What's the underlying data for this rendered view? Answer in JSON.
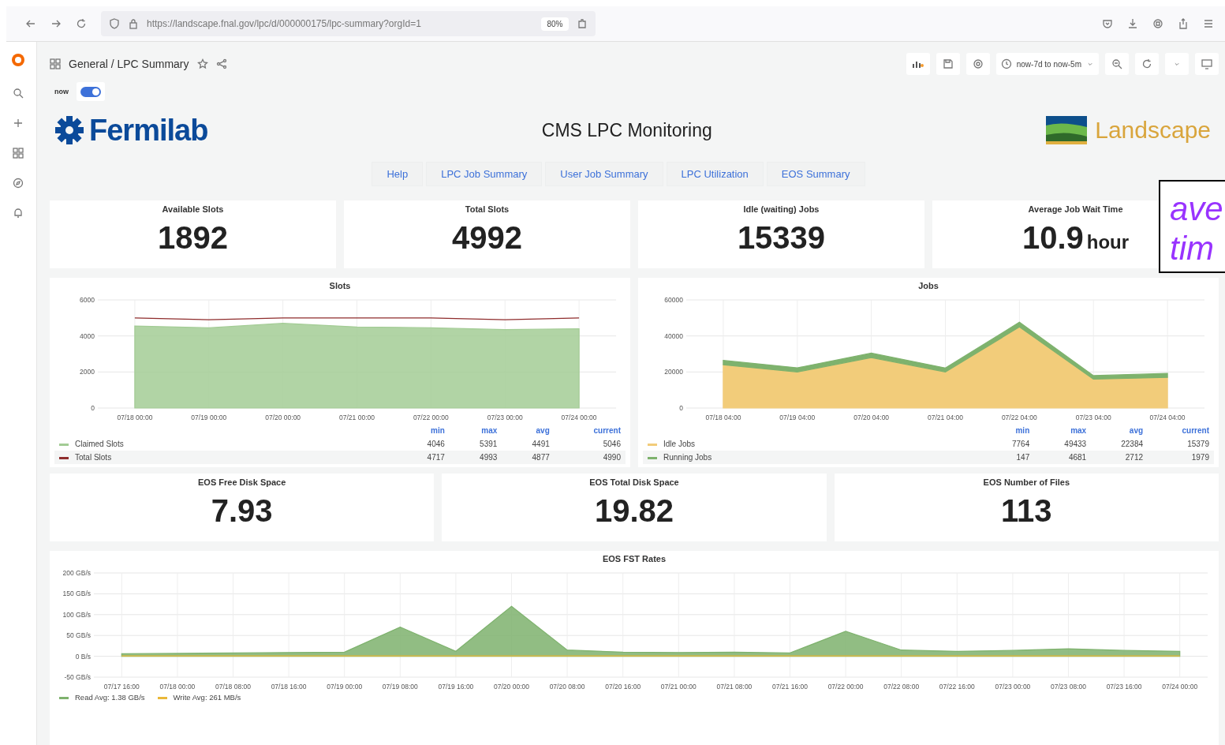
{
  "browser": {
    "url": "https://landscape.fnal.gov/lpc/d/000000175/lpc-summary?orgId=1",
    "zoom": "80%"
  },
  "dashboard": {
    "breadcrumb": "General / LPC Summary",
    "time_range": "now-7d to now-5m"
  },
  "toggle": {
    "label": "now",
    "on": true
  },
  "header": {
    "left_logo": "Fermilab",
    "title": "CMS LPC Monitoring",
    "right_logo": "Landscape"
  },
  "nav_links": [
    "Help",
    "LPC Job Summary",
    "User Job Summary",
    "LPC Utilization",
    "EOS Summary"
  ],
  "stats": [
    {
      "title": "Available Slots",
      "value": "1892"
    },
    {
      "title": "Total Slots",
      "value": "4992"
    },
    {
      "title": "Idle (waiting) Jobs",
      "value": "15339"
    },
    {
      "title": "Average Job Wait Time",
      "value": "10.9",
      "unit": "hour"
    }
  ],
  "charts": [
    {
      "title": "Slots",
      "legend": {
        "headers": [
          "min",
          "max",
          "avg",
          "current"
        ],
        "rows": [
          {
            "min": "4046",
            "max": "5391",
            "avg": "4491",
            "current": "5046"
          },
          {
            "min": "4717",
            "max": "4993",
            "avg": "4877",
            "current": "4990"
          }
        ]
      },
      "chart_data": {
        "type": "area",
        "grid": true,
        "categories": [
          "07/18 00:00",
          "07/19 00:00",
          "07/20 00:00",
          "07/21 00:00",
          "07/22 00:00",
          "07/23 00:00",
          "07/24 00:00"
        ],
        "ylim": [
          0,
          6000
        ],
        "yticks": [
          0,
          2000,
          4000,
          6000
        ],
        "stacked": false,
        "series": [
          {
            "name": "Claimed Slots",
            "color": "#a3cc95",
            "values": [
              4550,
              4450,
              4700,
              4500,
              4450,
              4350,
              4400
            ]
          },
          {
            "name": "Total Slots",
            "type": "line",
            "color": "#8f2d2d",
            "values": [
              5000,
              4900,
              5000,
              5000,
              5000,
              4900,
              5000
            ]
          }
        ]
      }
    },
    {
      "title": "Jobs",
      "legend": {
        "headers": [
          "min",
          "max",
          "avg",
          "current"
        ],
        "rows": [
          {
            "min": "7764",
            "max": "49433",
            "avg": "22384",
            "current": "15379"
          },
          {
            "min": "147",
            "max": "4681",
            "avg": "2712",
            "current": "1979"
          }
        ]
      },
      "chart_data": {
        "type": "area",
        "grid": true,
        "categories": [
          "07/18 04:00",
          "07/19 04:00",
          "07/20 04:00",
          "07/21 04:00",
          "07/22 04:00",
          "07/23 04:00",
          "07/24 04:00"
        ],
        "ylim": [
          0,
          60000
        ],
        "yticks": [
          0,
          20000,
          40000,
          60000
        ],
        "stacked": true,
        "series": [
          {
            "name": "Idle Jobs",
            "color": "#f2cc7a",
            "values": [
              24000,
              20000,
              28000,
              20000,
              45000,
              16000,
              17000
            ]
          },
          {
            "name": "Running Jobs",
            "color": "#7eb26d",
            "values": [
              2400,
              2300,
              2500,
              2200,
              2600,
              2000,
              2200
            ]
          }
        ]
      }
    }
  ],
  "stats2": [
    {
      "title": "EOS Free Disk Space",
      "value": "7.93"
    },
    {
      "title": "EOS Total Disk Space",
      "value": "19.82"
    },
    {
      "title": "EOS Number of Files",
      "value": "113"
    }
  ],
  "eos": {
    "title": "EOS FST Rates",
    "legend": [
      "Avg: 1.38 GB/s",
      "Avg: 261 MB/s"
    ],
    "chart_data": {
      "type": "area",
      "grid": true,
      "categories": [
        "07/17 16:00",
        "07/18 00:00",
        "07/18 08:00",
        "07/18 16:00",
        "07/19 00:00",
        "07/19 08:00",
        "07/19 16:00",
        "07/20 00:00",
        "07/20 08:00",
        "07/20 16:00",
        "07/21 00:00",
        "07/21 08:00",
        "07/21 16:00",
        "07/22 00:00",
        "07/22 08:00",
        "07/22 16:00",
        "07/23 00:00",
        "07/23 08:00",
        "07/23 16:00",
        "07/24 00:00"
      ],
      "ylim": [
        -50,
        200
      ],
      "yticks": [
        {
          "value": -50,
          "label": "-50 GB/s"
        },
        {
          "value": 0,
          "label": "0 B/s"
        },
        {
          "value": 50,
          "label": "50 GB/s"
        },
        {
          "value": 100,
          "label": "100 GB/s"
        },
        {
          "value": 150,
          "label": "150 GB/s"
        },
        {
          "value": 200,
          "label": "200 GB/s"
        }
      ],
      "stacked": false,
      "series": [
        {
          "name": "Read",
          "color": "#7eb26d",
          "values": [
            6,
            7,
            8,
            9,
            10,
            70,
            12,
            120,
            15,
            10,
            9,
            10,
            8,
            60,
            15,
            12,
            14,
            18,
            14,
            12
          ]
        },
        {
          "name": "Write",
          "type": "line",
          "color": "#eab839",
          "values": [
            1,
            1,
            1,
            1,
            1,
            1,
            1,
            1,
            1,
            1,
            1,
            1,
            1,
            1,
            1,
            1,
            1,
            1,
            1,
            1
          ]
        }
      ]
    }
  },
  "annotation": {
    "lines": [
      "ave",
      "tim"
    ]
  }
}
